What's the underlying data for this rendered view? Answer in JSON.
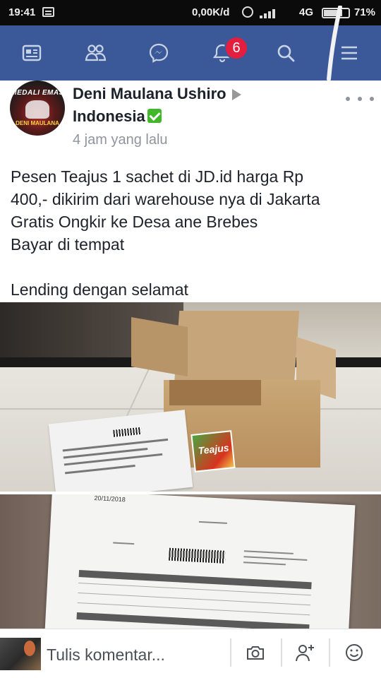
{
  "status_bar": {
    "time": "19:41",
    "speed": "0,00K/d",
    "network": "4G",
    "battery": "71%"
  },
  "nav": {
    "items": [
      {
        "icon": "news-feed-icon"
      },
      {
        "icon": "friends-icon"
      },
      {
        "icon": "messenger-icon"
      },
      {
        "icon": "notifications-icon",
        "badge": "6"
      },
      {
        "icon": "search-icon"
      },
      {
        "icon": "menu-icon"
      }
    ],
    "bar_color": "#3b5998",
    "badge_color": "#e41e3f"
  },
  "post": {
    "author_line1": "Deni Maulana Ushiro",
    "author_line2": "Indonesia",
    "timestamp": "4 jam yang lalu",
    "avatar_text_top": "MEDALI EMAS",
    "avatar_text_bottom": "DENI MAULANA",
    "text_lines": [
      "Pesen Teajus 1 sachet di JD.id harga Rp",
      "400,- dikirim dari warehouse nya di Jakarta",
      "Gratis Ongkir ke Desa ane Brebes",
      "Bayar di tempat",
      "",
      "Lending dengan selamat"
    ],
    "photo1": {
      "sachet_label": "Teajus"
    },
    "photo2": {
      "invoice_date": "20/11/2018"
    }
  },
  "comment_bar": {
    "placeholder": "Tulis komentar...",
    "icons": [
      "camera-icon",
      "add-person-icon",
      "emoji-icon"
    ]
  }
}
